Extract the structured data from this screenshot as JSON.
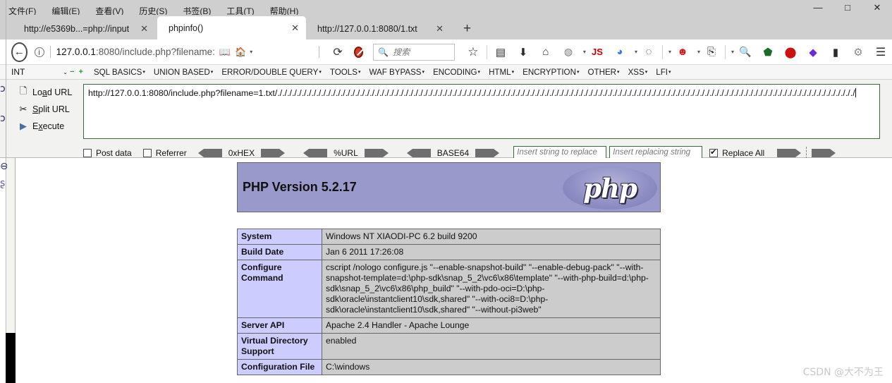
{
  "window": {
    "menu_items": [
      "文件(F)",
      "编辑(E)",
      "查看(V)",
      "历史(S)",
      "书签(B)",
      "工具(T)",
      "帮助(H)"
    ],
    "minimize": "—",
    "maximize": "□",
    "close": "✕"
  },
  "tabs": [
    {
      "title": "http://e5369b...=php://input",
      "close": "✕",
      "active": false
    },
    {
      "title": "phpinfo()",
      "close": "✕",
      "active": true
    },
    {
      "title": "http://127.0.0.1:8080/1.txt",
      "close": "✕",
      "active": false
    }
  ],
  "new_tab_label": "+",
  "navbar": {
    "back_glyph": "←",
    "info_glyph": "i",
    "url_head": "127.0.0.1",
    "url_tail": ":8080/include.php?filename:",
    "reader_icon": "book-icon",
    "home_icon": "home-icon",
    "caret": "▾",
    "reload_glyph": "⟳",
    "search_placeholder": "搜索",
    "search_icon": "🔍",
    "toolbar_icons": [
      "☆",
      "▤",
      "⬇",
      "⌂",
      "◍",
      "JS",
      "◕",
      "▾",
      "☻",
      "▾",
      "⎘",
      "▾",
      "🔍",
      "W",
      "ABP",
      "◆",
      "∏",
      "⚙",
      "☰"
    ]
  },
  "hackbar": {
    "type_selector": "INT",
    "selector_caret": "⌄",
    "minus_icon": "−",
    "plus_icon": "+",
    "menus": [
      "SQL BASICS",
      "UNION BASED",
      "ERROR/DOUBLE QUERY",
      "TOOLS",
      "WAF BYPASS",
      "ENCODING",
      "HTML",
      "ENCRYPTION",
      "OTHER",
      "XSS",
      "LFI"
    ],
    "menu_caret": "▾",
    "actions": [
      {
        "icon": "load-url-icon",
        "label_pre": "Lo",
        "label_key": "a",
        "label_post": "d URL"
      },
      {
        "icon": "split-url-icon",
        "label_pre": "",
        "label_key": "S",
        "label_post": "plit URL"
      },
      {
        "icon": "execute-icon",
        "label_pre": "E",
        "label_key": "x",
        "label_post": "ecute"
      }
    ],
    "url_value": "http://127.0.0.1:8080/include.php?filename=1.txt/./././././././././././././././././././././././././././././././././././././././././././././././././././././././././././././././././././././././././././././././././././././././././././././././././././././././././././././././././././././././",
    "post_data_label": "Post data",
    "post_data_checked": false,
    "referrer_label": "Referrer",
    "referrer_checked": false,
    "encoders": [
      "0xHEX",
      "%URL",
      "BASE64"
    ],
    "replace_find_placeholder": "Insert string to replace",
    "replace_with_placeholder": "Insert replacing string",
    "replace_all_label": "Replace All",
    "replace_all_checked": true
  },
  "phpinfo": {
    "version_title": "PHP Version 5.2.17",
    "logo_text": "php",
    "rows": [
      {
        "key": "System",
        "value": "Windows NT XIAODI-PC 6.2 build 9200"
      },
      {
        "key": "Build Date",
        "value": "Jan 6 2011 17:26:08"
      },
      {
        "key": "Configure Command",
        "value": "cscript /nologo configure.js \"--enable-snapshot-build\" \"--enable-debug-pack\" \"--with-snapshot-template=d:\\php-sdk\\snap_5_2\\vc6\\x86\\template\" \"--with-php-build=d:\\php-sdk\\snap_5_2\\vc6\\x86\\php_build\" \"--with-pdo-oci=D:\\php-sdk\\oracle\\instantclient10\\sdk,shared\" \"--with-oci8=D:\\php-sdk\\oracle\\instantclient10\\sdk,shared\" \"--without-pi3web\""
      },
      {
        "key": "Server API",
        "value": "Apache 2.4 Handler - Apache Lounge"
      },
      {
        "key": "Virtual Directory Support",
        "value": "enabled"
      },
      {
        "key": "Configuration File",
        "value": "C:\\windows"
      }
    ]
  },
  "watermark": "CSDN @大不为王"
}
